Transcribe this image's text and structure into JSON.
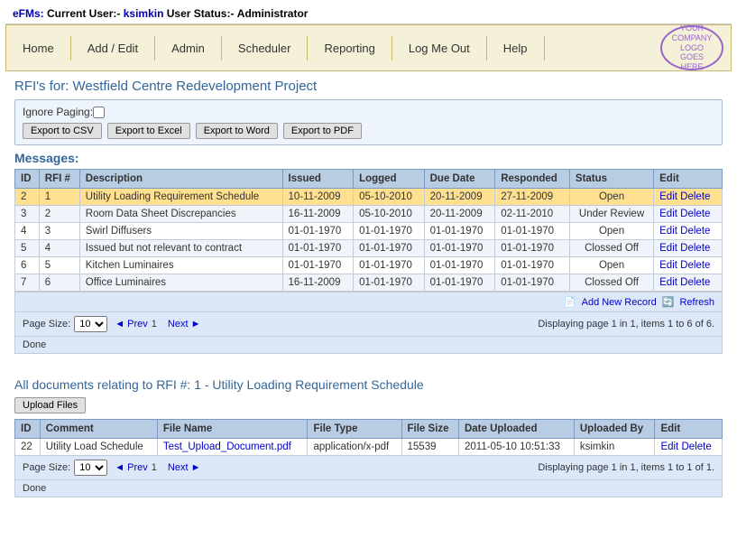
{
  "header": {
    "prefix": "eFMs:",
    "current_user_label": "Current User:-",
    "username": "ksimkin",
    "user_status_label": "User Status:-",
    "user_role": "Administrator"
  },
  "navbar": {
    "items": [
      {
        "label": "Home",
        "id": "home"
      },
      {
        "label": "Add / Edit",
        "id": "add-edit"
      },
      {
        "label": "Admin",
        "id": "admin"
      },
      {
        "label": "Scheduler",
        "id": "scheduler"
      },
      {
        "label": "Reporting",
        "id": "reporting"
      },
      {
        "label": "Log Me Out",
        "id": "log-me-out"
      },
      {
        "label": "Help",
        "id": "help"
      }
    ],
    "logo_text": "YOUR\nCOMPANY LOGO\nGOES\nHERE"
  },
  "rfi_section": {
    "title": "RFI's for: Westfield Centre Redevelopment Project",
    "ignore_paging_label": "Ignore Paging:",
    "export_buttons": [
      {
        "label": "Export to CSV",
        "id": "export-csv"
      },
      {
        "label": "Export to Excel",
        "id": "export-excel"
      },
      {
        "label": "Export to Word",
        "id": "export-word"
      },
      {
        "label": "Export to PDF",
        "id": "export-pdf"
      }
    ],
    "messages_header": "Messages:",
    "table": {
      "columns": [
        "ID",
        "RFI #",
        "Description",
        "Issued",
        "Logged",
        "Due Date",
        "Responded",
        "Status",
        "Edit"
      ],
      "rows": [
        {
          "id": "2",
          "rfi": "1",
          "description": "Utility Loading Requirement Schedule",
          "issued": "10-11-2009",
          "logged": "05-10-2010",
          "due_date": "20-11-2009",
          "responded": "27-11-2009",
          "status": "Open",
          "highlighted": true
        },
        {
          "id": "3",
          "rfi": "2",
          "description": "Room Data Sheet Discrepancies",
          "issued": "16-11-2009",
          "logged": "05-10-2010",
          "due_date": "20-11-2009",
          "responded": "02-11-2010",
          "status": "Under Review",
          "highlighted": false
        },
        {
          "id": "4",
          "rfi": "3",
          "description": "Swirl Diffusers",
          "issued": "01-01-1970",
          "logged": "01-01-1970",
          "due_date": "01-01-1970",
          "responded": "01-01-1970",
          "status": "Open",
          "highlighted": false
        },
        {
          "id": "5",
          "rfi": "4",
          "description": "Issued but not relevant to contract",
          "issued": "01-01-1970",
          "logged": "01-01-1970",
          "due_date": "01-01-1970",
          "responded": "01-01-1970",
          "status": "Clossed Off",
          "highlighted": false
        },
        {
          "id": "6",
          "rfi": "5",
          "description": "Kitchen Luminaires",
          "issued": "01-01-1970",
          "logged": "01-01-1970",
          "due_date": "01-01-1970",
          "responded": "01-01-1970",
          "status": "Open",
          "highlighted": false
        },
        {
          "id": "7",
          "rfi": "6",
          "description": "Office Luminaires",
          "issued": "16-11-2009",
          "logged": "01-01-1970",
          "due_date": "01-01-1970",
          "responded": "01-01-1970",
          "status": "Clossed Off",
          "highlighted": false
        }
      ],
      "add_record_label": "Add New Record",
      "refresh_label": "Refresh"
    },
    "pagination": {
      "page_size_label": "Page Size:",
      "page_size_value": "10",
      "prev_label": "◄ Prev",
      "next_label": "Next ►",
      "display_info": "Displaying page 1 in 1, items 1 to 6 of 6."
    },
    "status": "Done"
  },
  "document_section": {
    "title": "All documents relating to RFI #: 1 - Utility Loading Requirement Schedule",
    "upload_button_label": "Upload Files",
    "table": {
      "columns": [
        "ID",
        "Comment",
        "File Name",
        "File Type",
        "File Size",
        "Date Uploaded",
        "Uploaded By",
        "Edit"
      ],
      "rows": [
        {
          "id": "22",
          "comment": "Utility Load Schedule",
          "file_name": "Test_Upload_Document.pdf",
          "file_type": "application/x-pdf",
          "file_size": "15539",
          "date_uploaded": "2011-05-10 10:51:33",
          "uploaded_by": "ksimkin"
        }
      ]
    },
    "pagination": {
      "page_size_label": "Page Size:",
      "page_size_value": "10",
      "prev_label": "◄ Prev",
      "next_label": "Next ►",
      "display_info": "Displaying page 1 in 1, items 1 to 1 of 1."
    },
    "status": "Done"
  }
}
